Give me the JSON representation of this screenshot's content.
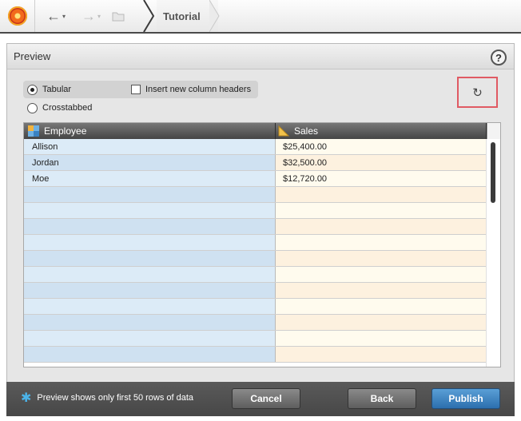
{
  "toolbar": {
    "logo_icon": "sun-logo-icon",
    "back_icon": "arrow-left-icon",
    "forward_icon": "arrow-right-icon",
    "folder_icon": "folder-icon",
    "breadcrumb": "Tutorial"
  },
  "dialog": {
    "title": "Preview",
    "help_label": "?",
    "options": {
      "tabular_label": "Tabular",
      "tabular_selected": true,
      "crosstabbed_label": "Crosstabbed",
      "crosstabbed_selected": false,
      "insert_headers_label": "Insert new column headers",
      "insert_headers_checked": false
    },
    "refresh_icon": "refresh-icon",
    "grid": {
      "columns": [
        {
          "label": "Employee",
          "icon": "dimension-icon"
        },
        {
          "label": "Sales",
          "icon": "measure-icon"
        }
      ],
      "rows": [
        {
          "employee": "Allison",
          "sales": "$25,400.00"
        },
        {
          "employee": "Jordan",
          "sales": "$32,500.00"
        },
        {
          "employee": "Moe",
          "sales": "$12,720.00"
        }
      ],
      "empty_row_count": 11
    }
  },
  "footer": {
    "note_icon": "star-icon",
    "note": "Preview shows only first 50 rows of data",
    "cancel_label": "Cancel",
    "back_label": "Back",
    "publish_label": "Publish"
  },
  "colors": {
    "accent": "#3a82c2",
    "highlight_border": "#e05a63",
    "dimension_column": "#dcebf7",
    "measure_column": "#fffbee"
  }
}
